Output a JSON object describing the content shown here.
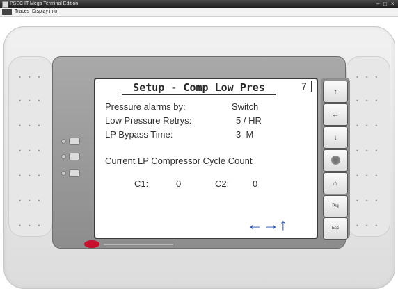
{
  "window": {
    "title": "PSEC IT Mega Terminal Edition",
    "controls": [
      "–",
      "□",
      "×"
    ]
  },
  "menu": {
    "items": [
      "Traces",
      "Display info"
    ]
  },
  "screen": {
    "header": "Setup - Comp Low Pres",
    "page_number": "7",
    "rows": [
      {
        "label": "Pressure alarms by:",
        "value": "Switch"
      },
      {
        "label": "Low Pressure Retrys:",
        "value": "5 / HR"
      },
      {
        "label": "LP Bypass Time:",
        "value": "3  M"
      }
    ],
    "cycle_count_title": "Current LP Compressor Cycle Count",
    "c1_label": "C1:",
    "c1_value": "0",
    "c2_label": "C2:",
    "c2_value": "0",
    "nav_arrows": "←→↑"
  },
  "keys": [
    {
      "name": "up-key",
      "glyph": "↑"
    },
    {
      "name": "enter-key",
      "glyph": "←"
    },
    {
      "name": "down-key",
      "glyph": "↓"
    },
    {
      "name": "menu-key",
      "glyph": ""
    },
    {
      "name": "home-key",
      "glyph": "⌂"
    },
    {
      "name": "prg-key",
      "glyph": "Prg"
    },
    {
      "name": "esc-key",
      "glyph": "Esc"
    }
  ],
  "colors": {
    "arrow_blue": "#1f4fb3",
    "logo_red": "#c8102e"
  }
}
